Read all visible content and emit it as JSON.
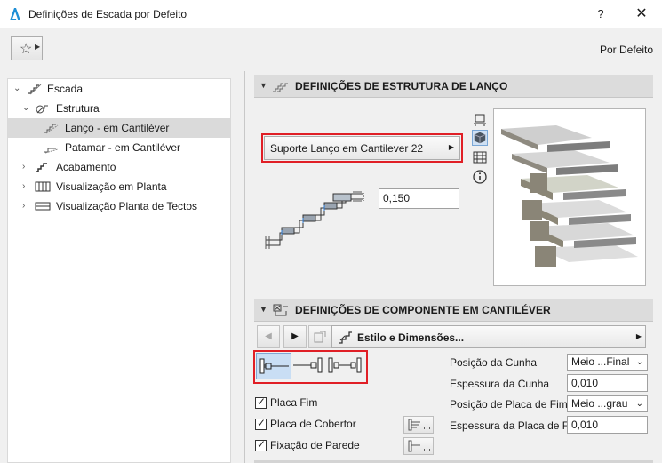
{
  "window": {
    "title": "Definições de Escada por Defeito",
    "help_label": "?",
    "close_label": "✕"
  },
  "toolbar": {
    "favorites_icon": "star-favorites-icon",
    "default_label": "Por Defeito"
  },
  "tree": {
    "items": [
      {
        "label": "Escada",
        "icon": "stair-icon"
      },
      {
        "label": "Estrutura",
        "icon": "structure-icon"
      },
      {
        "label": "Lanço - em Cantiléver",
        "icon": "flight-icon",
        "selected": true
      },
      {
        "label": "Patamar - em Cantiléver",
        "icon": "landing-icon"
      },
      {
        "label": "Acabamento",
        "icon": "finish-icon"
      },
      {
        "label": "Visualização em Planta",
        "icon": "floor-plan-icon"
      },
      {
        "label": "Visualização Planta de Tectos",
        "icon": "ceiling-plan-icon"
      }
    ]
  },
  "flight_section": {
    "title": "DEFINIÇÕES DE ESTRUTURA DE LANÇO",
    "profile_button": "Suporte Lanço em Cantilever 22",
    "thickness_value": "0,150"
  },
  "cantilever_section": {
    "title": "DEFINIÇÕES DE COMPONENTE EM CANTILÉVER",
    "style_dropdown": "Estilo e Dimensões...",
    "properties": [
      {
        "label": "Posição da Cunha",
        "type": "select",
        "value": "Meio ...Final"
      },
      {
        "label": "Espessura da Cunha",
        "type": "input",
        "value": "0,010"
      },
      {
        "label": "Posição de Placa de Fim",
        "type": "select",
        "value": "Meio ...grau"
      },
      {
        "label": "Espessura da Placa de Fim",
        "type": "input",
        "value": "0,010"
      }
    ],
    "checkboxes": [
      {
        "label": "Placa Fim",
        "checked": true
      },
      {
        "label": "Placa de Cobertor",
        "checked": true
      },
      {
        "label": "Fixação de Parede",
        "checked": true
      }
    ]
  },
  "colors": {
    "highlight_red": "#e01f26",
    "selection_gray": "#dadada",
    "header_gray": "#dcdcdc"
  }
}
